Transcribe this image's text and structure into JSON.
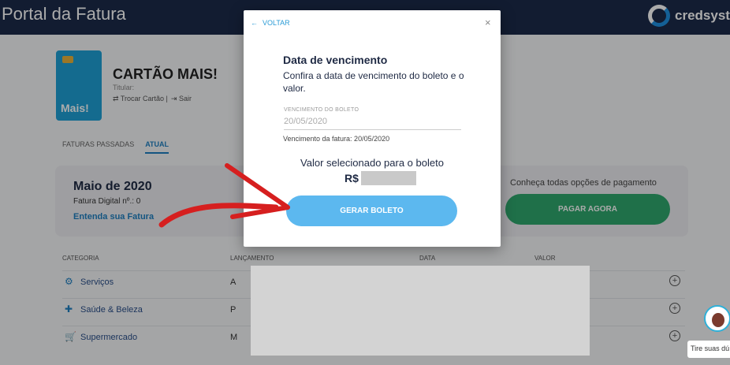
{
  "header": {
    "title": "Portal da Fatura",
    "brand": "credsyste"
  },
  "card": {
    "name": "CARTÃO MAIS!",
    "holder_label": "Titular:",
    "trocar_label": "⇄ Trocar Cartão |",
    "sair_label": "⇥ Sair",
    "card_brand_text": "Mais!"
  },
  "tabs": {
    "past": "FATURAS PASSADAS",
    "current": "ATUAL"
  },
  "summary": {
    "month": "Maio de 2020",
    "digital": "Fatura Digital nº.: 0",
    "entenda": "Entenda sua Fatura",
    "options": "Conheça todas opções de pagamento",
    "pagar": "PAGAR AGORA"
  },
  "table": {
    "headers": {
      "categoria": "CATEGORIA",
      "lancamento": "LANÇAMENTO",
      "data": "DATA",
      "valor": "VALOR"
    },
    "rows": [
      {
        "categoria": "Serviços",
        "lancamento": "A",
        "icon": "services-icon"
      },
      {
        "categoria": "Saúde & Beleza",
        "lancamento": "P",
        "icon": "health-icon"
      },
      {
        "categoria": "Supermercado",
        "lancamento": "M",
        "icon": "cart-icon"
      }
    ]
  },
  "chat": {
    "tip": "Tire suas dú"
  },
  "modal": {
    "back": "VOLTAR",
    "close": "×",
    "title": "Data de vencimento",
    "subtitle": "Confira a data de vencimento do boleto e o valor.",
    "field_label": "VENCIMENTO DO BOLETO",
    "field_value": "20/05/2020",
    "help": "Vencimento da fatura: 20/05/2020",
    "valor_title": "Valor selecionado para o boleto",
    "currency": "R$",
    "gerar": "GERAR BOLETO"
  },
  "colors": {
    "accent": "#5cb8ef",
    "pagar": "#2fa86e",
    "header": "#1b2a4a",
    "arrow": "#d61f1f"
  }
}
